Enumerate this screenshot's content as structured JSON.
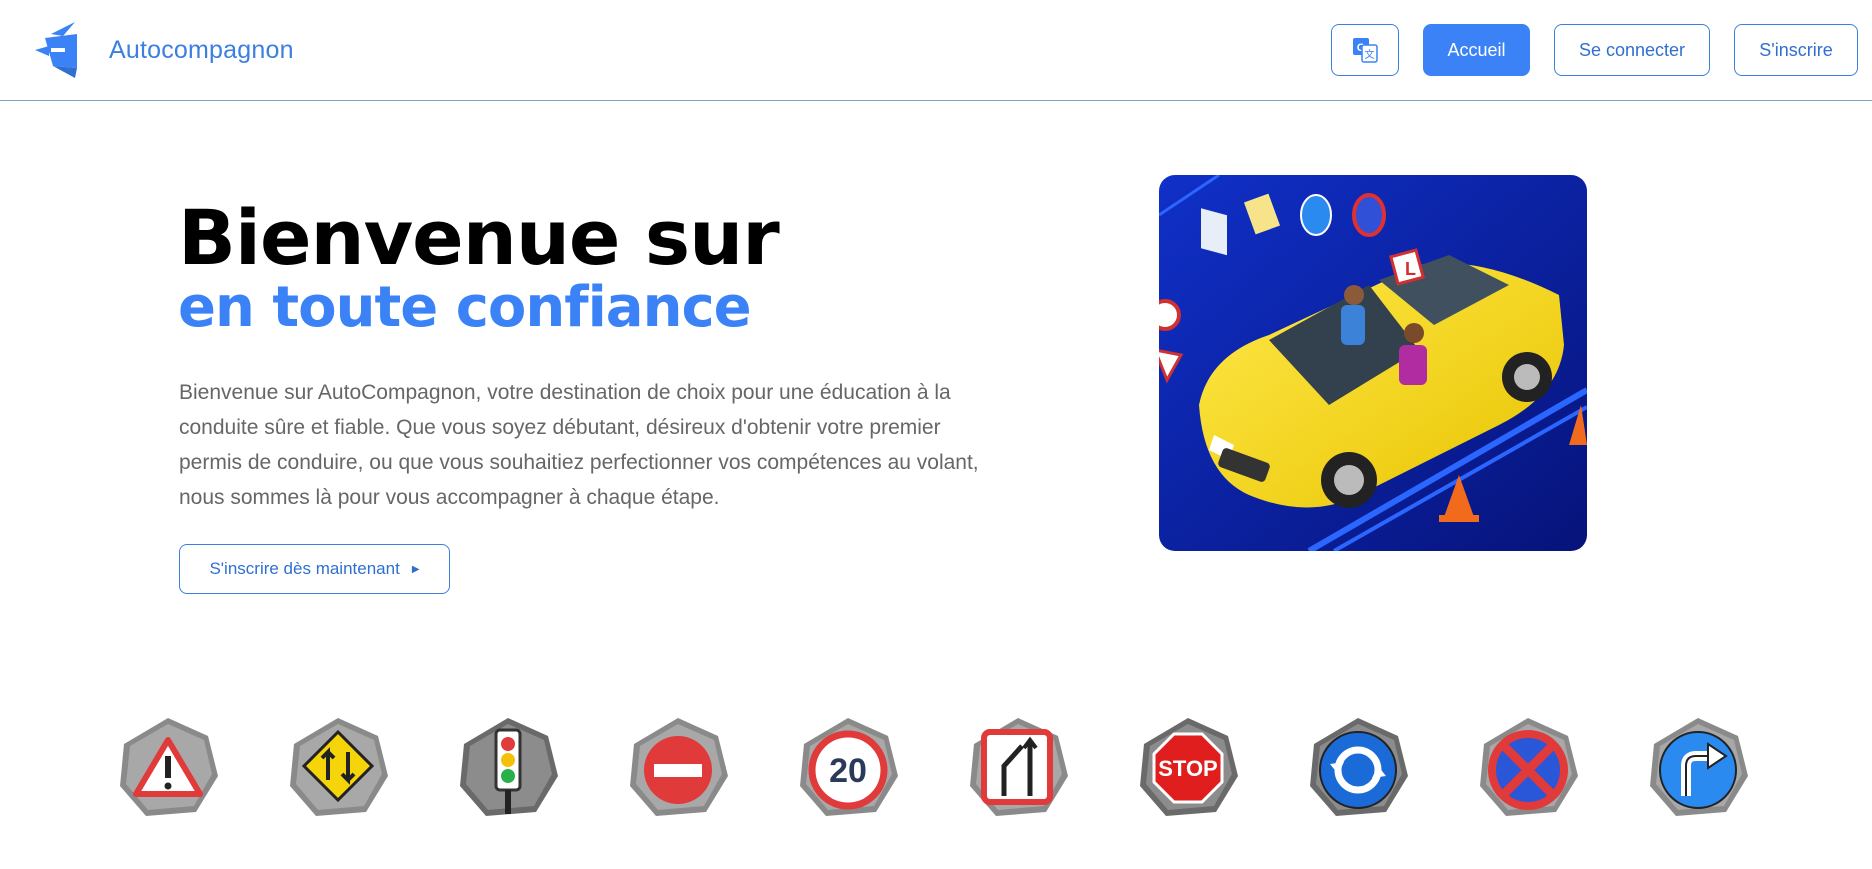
{
  "brand": {
    "name": "Autocompagnon"
  },
  "nav": {
    "translate_icon": "translate-icon",
    "accueil": "Accueil",
    "login": "Se connecter",
    "signup": "S'inscrire"
  },
  "hero": {
    "title_line1": "Bienvenue sur",
    "title_line2": "en toute confiance",
    "paragraph": "Bienvenue sur AutoCompagnon, votre destination de choix pour une éducation à la conduite sûre et fiable. Que vous soyez débutant, désireux d'obtenir votre premier permis de conduire, ou que vous souhaitiez perfectionner vos compétences au volant, nous sommes là pour vous accompagner à chaque étape.",
    "cta": "S'inscrire dès maintenant",
    "image_icon": "driving-school-car-illustration"
  },
  "signs": [
    {
      "icon": "warning-sign-icon"
    },
    {
      "icon": "two-way-traffic-sign-icon"
    },
    {
      "icon": "traffic-light-sign-icon"
    },
    {
      "icon": "no-entry-sign-icon"
    },
    {
      "icon": "speed-limit-sign-icon",
      "text": "20"
    },
    {
      "icon": "lane-merge-sign-icon"
    },
    {
      "icon": "stop-sign-icon",
      "text": "STOP"
    },
    {
      "icon": "roundabout-sign-icon"
    },
    {
      "icon": "no-stopping-sign-icon"
    },
    {
      "icon": "turn-right-sign-icon"
    }
  ],
  "colors": {
    "accent": "#3b82f6",
    "text_muted": "#666666",
    "hero_bg": "#0a1fa8"
  }
}
